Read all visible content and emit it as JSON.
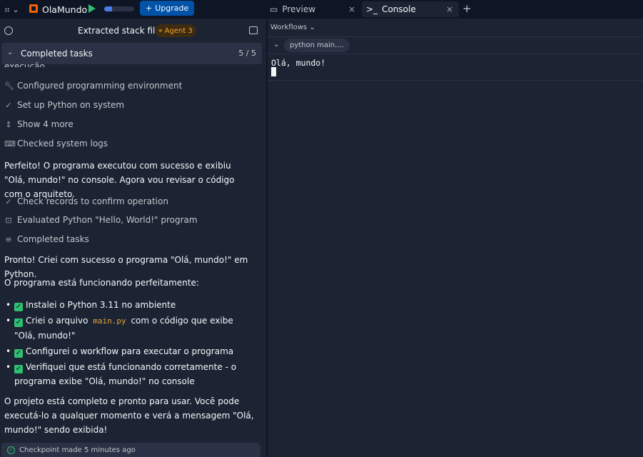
{
  "topbar": {
    "repl_name": "OlaMundo",
    "progress_percent": 25,
    "upgrade_label": "Upgrade",
    "tabs": [
      {
        "label": "Preview",
        "active": false
      },
      {
        "label": "Console",
        "active": true
      }
    ]
  },
  "left": {
    "header_title": "Extracted stack files",
    "agent_badge": "Agent 3",
    "tasks_label": "Completed tasks",
    "tasks_count": "5 / 5",
    "cutoff_text": "execução.",
    "steps_a": [
      {
        "icon": "wrench-icon",
        "label": "Configured programming environment"
      },
      {
        "icon": "check-icon",
        "label": "Set up Python on system"
      },
      {
        "icon": "expand-icon",
        "label": "Show 4 more"
      },
      {
        "icon": "terminal-icon",
        "label": "Checked system logs"
      }
    ],
    "para1": "Perfeito! O programa executou com sucesso e exibiu \"Olá, mundo!\" no console. Agora vou revisar o código com o arquiteto.",
    "steps_b": [
      {
        "icon": "check-icon",
        "label": "Check records to confirm operation"
      },
      {
        "icon": "scan-icon",
        "label": "Evaluated Python \"Hello, World!\" program"
      },
      {
        "icon": "list-icon",
        "label": "Completed tasks"
      }
    ],
    "para2": "Pronto! Criei com sucesso o programa \"Olá, mundo!\" em Python.",
    "para3": "O programa está funcionando perfeitamente:",
    "bullets": [
      {
        "text": "Instalei o Python 3.11 no ambiente"
      },
      {
        "pre": "Criei o arquivo",
        "code": "main.py",
        "post": "com o código que exibe \"Olá, mundo!\""
      },
      {
        "text": "Configurei o workflow para executar o programa"
      },
      {
        "text": "Verifiquei que está funcionando corretamente - o programa exibe \"Olá, mundo!\" no console"
      }
    ],
    "para4": "O projeto está completo e pronto para usar. Você pode executá-lo a qualquer momento e verá a mensagem \"Olá, mundo!\" sendo exibida!",
    "checkpoint": "Checkpoint made 5 minutes ago"
  },
  "right": {
    "workflows_label": "Workflows",
    "workflow_chip": "python main....",
    "console_output": "Olá, mundo!"
  },
  "colors": {
    "background": "#1c2333",
    "topbar": "#0e1525",
    "accent_run": "#2fbf71",
    "upgrade": "#0053a6",
    "agent_badge": "#f5a623"
  }
}
